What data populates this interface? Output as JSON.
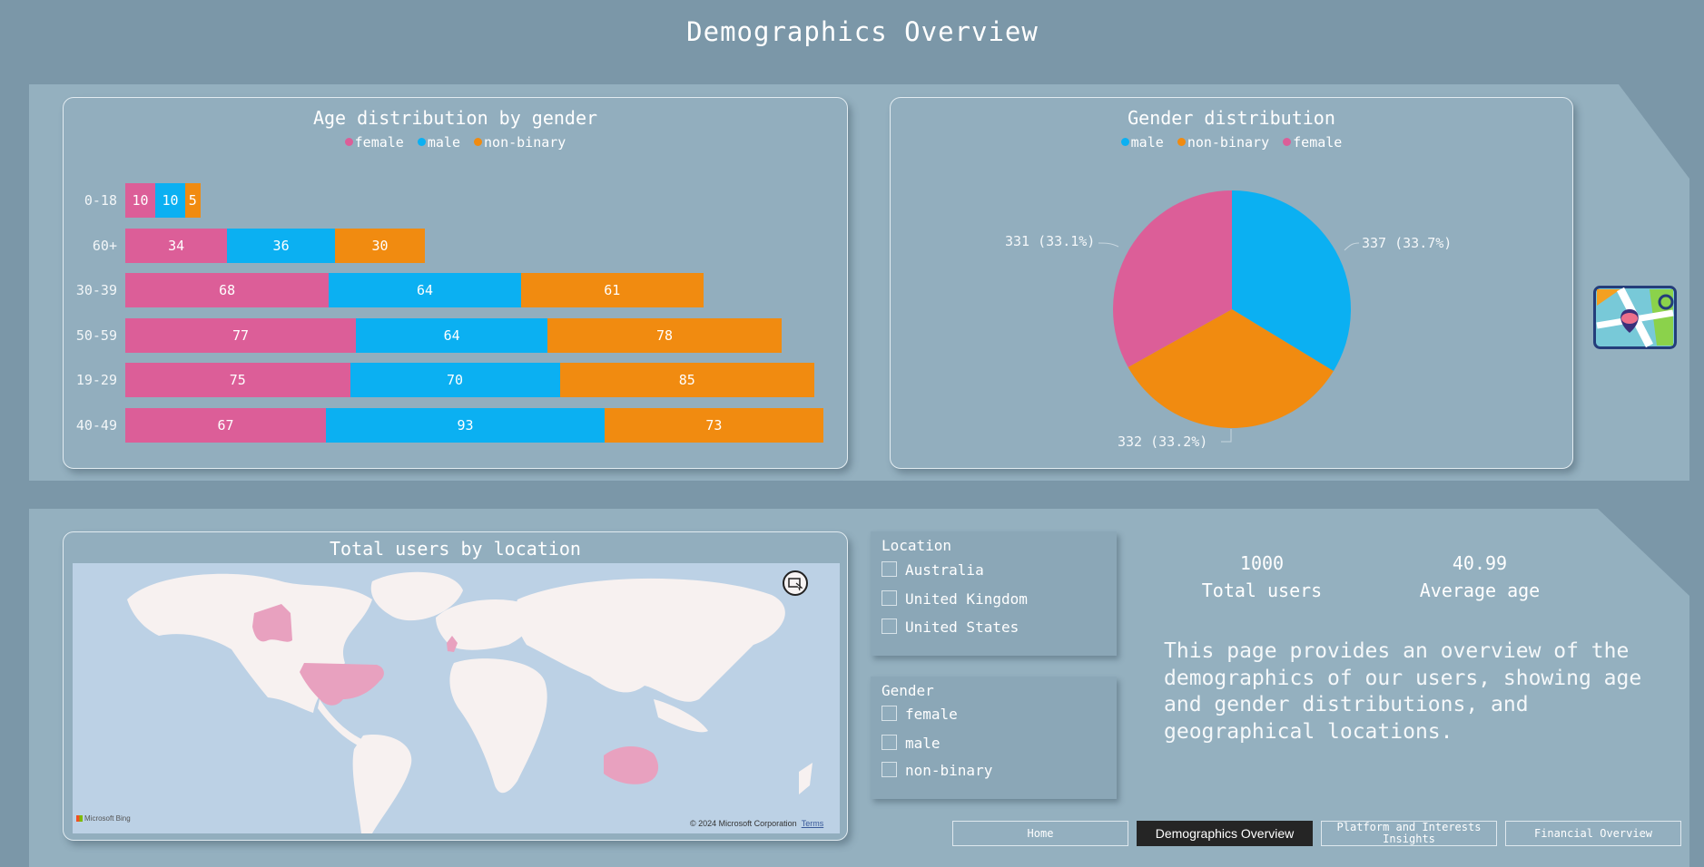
{
  "page": {
    "title": "Demographics Overview"
  },
  "colors": {
    "female": "#dc5e98",
    "male": "#0bb0f2",
    "non_binary": "#f18b10",
    "map_highlight": "#e8a1bf"
  },
  "age_chart": {
    "title": "Age distribution by gender",
    "legend": [
      "female",
      "male",
      "non-binary"
    ],
    "rows": [
      {
        "label": "0-18",
        "female": "10",
        "male": "10",
        "non_binary": "5"
      },
      {
        "label": "60+",
        "female": "34",
        "male": "36",
        "non_binary": "30"
      },
      {
        "label": "30-39",
        "female": "68",
        "male": "64",
        "non_binary": "61"
      },
      {
        "label": "50-59",
        "female": "77",
        "male": "64",
        "non_binary": "78"
      },
      {
        "label": "19-29",
        "female": "75",
        "male": "70",
        "non_binary": "85"
      },
      {
        "label": "40-49",
        "female": "67",
        "male": "93",
        "non_binary": "73"
      }
    ]
  },
  "gender_chart": {
    "title": "Gender distribution",
    "legend": [
      "male",
      "non-binary",
      "female"
    ],
    "labels": {
      "male": "337 (33.7%)",
      "non_binary": "332 (33.2%)",
      "female": "331 (33.1%)"
    }
  },
  "chart_data": [
    {
      "type": "bar",
      "title": "Age distribution by gender",
      "orientation": "horizontal-stacked",
      "categories": [
        "0-18",
        "60+",
        "30-39",
        "50-59",
        "19-29",
        "40-49"
      ],
      "series": [
        {
          "name": "female",
          "values": [
            10,
            34,
            68,
            77,
            75,
            67
          ]
        },
        {
          "name": "male",
          "values": [
            10,
            36,
            64,
            64,
            70,
            93
          ]
        },
        {
          "name": "non-binary",
          "values": [
            5,
            30,
            61,
            78,
            85,
            73
          ]
        }
      ],
      "legend": "top-center"
    },
    {
      "type": "pie",
      "title": "Gender distribution",
      "categories": [
        "male",
        "non-binary",
        "female"
      ],
      "values": [
        337,
        332,
        331
      ],
      "legend": "top-center"
    }
  ],
  "map": {
    "title": "Total users by location",
    "highlighted": [
      "Australia",
      "United Kingdom",
      "United States"
    ],
    "attribution": "Microsoft Bing",
    "copyright": "© 2024 Microsoft Corporation",
    "terms": "Terms",
    "logo_icon": "map-pin-icon",
    "focus_icon": "focus-mode-icon"
  },
  "filters": {
    "location": {
      "title": "Location",
      "options": [
        "Australia",
        "United Kingdom",
        "United States"
      ]
    },
    "gender": {
      "title": "Gender",
      "options": [
        "female",
        "male",
        "non-binary"
      ]
    }
  },
  "kpis": {
    "total_users": {
      "value": "1000",
      "label": "Total users"
    },
    "average_age": {
      "value": "40.99",
      "label": "Average age"
    }
  },
  "description": "This page provides an overview of the demographics of our users, showing age and gender distributions, and geographical locations.",
  "nav": [
    {
      "label": "Home",
      "active": false
    },
    {
      "label": "Demographics Overview",
      "active": true
    },
    {
      "label": "Platform and Interests Insights",
      "active": false
    },
    {
      "label": "Financial Overview",
      "active": false
    }
  ]
}
